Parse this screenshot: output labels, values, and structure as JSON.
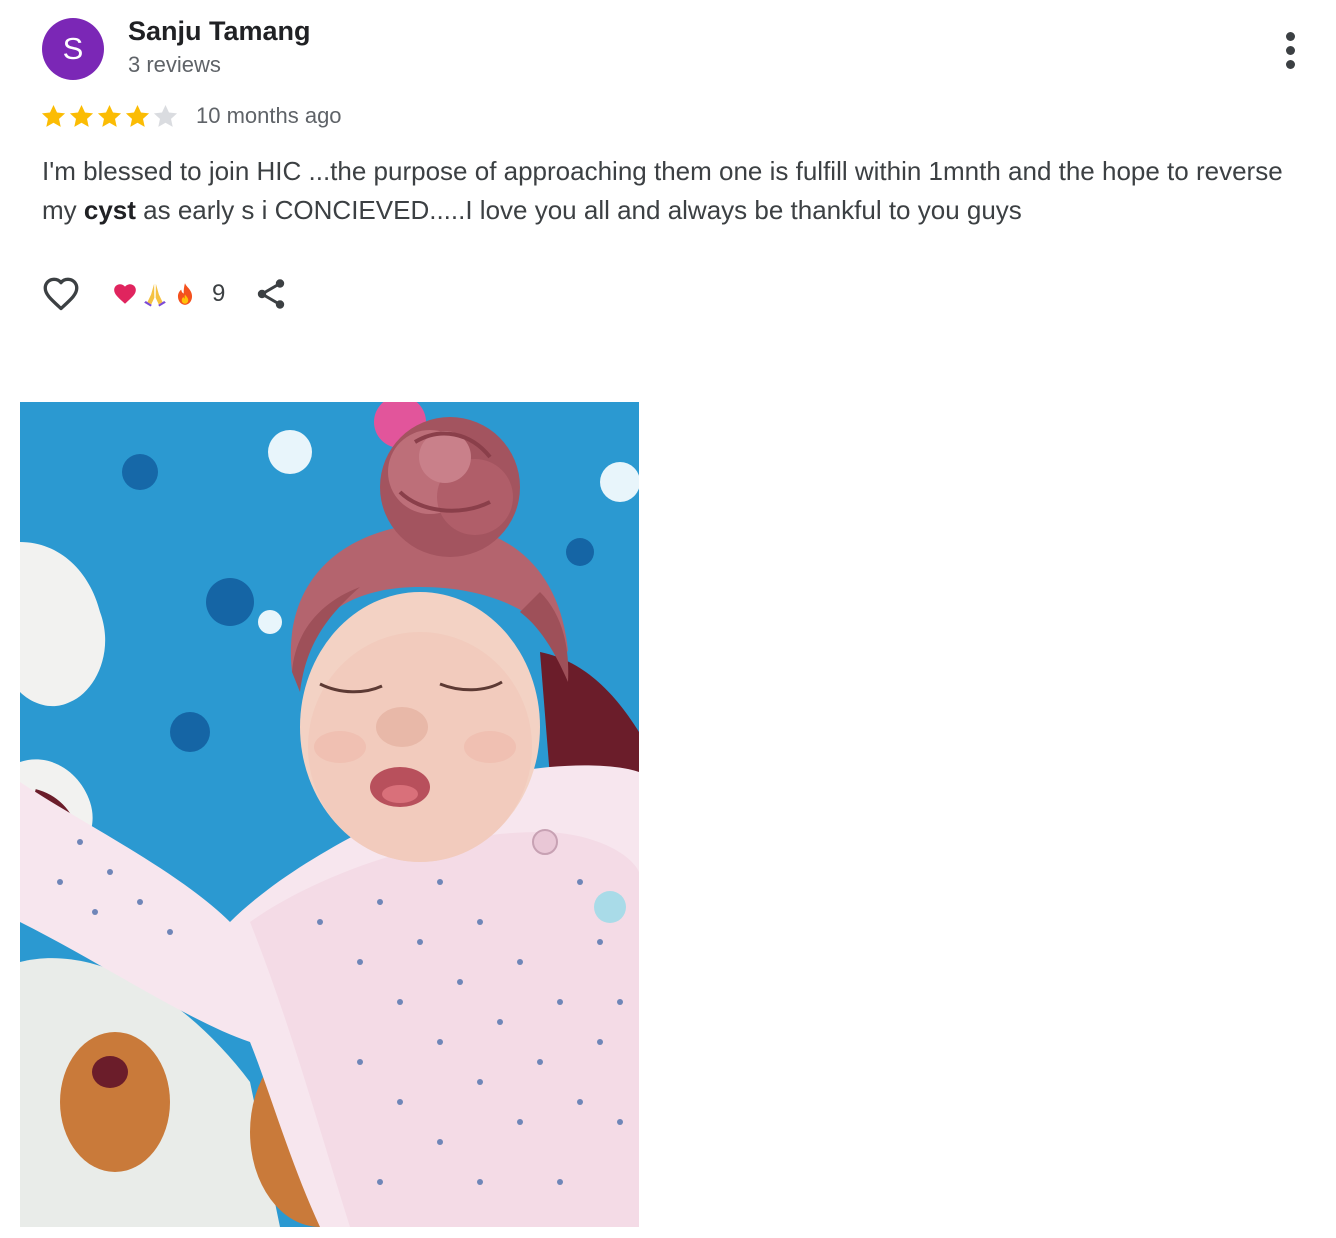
{
  "review": {
    "author": {
      "initial": "S",
      "name": "Sanju Tamang",
      "reviews_count": "3 reviews",
      "avatar_color": "#7b27b6"
    },
    "rating": {
      "stars": 4,
      "max": 5,
      "date": "10 months ago",
      "star_color": "#fbbc04",
      "empty_star_color": "#dadce0"
    },
    "text": {
      "part1": "I'm blessed to join HIC ...the purpose of approaching them one is fulfill within 1mnth and the hope to reverse my ",
      "highlight": "cyst",
      "part2": " as early s i CONCIEVED.....I love you all and always be thankful to you guys"
    },
    "actions": {
      "like_icon": "heart-outline-icon",
      "reactions": [
        "heart-emoji",
        "praying-hands-emoji",
        "fire-emoji"
      ],
      "reaction_count": "9",
      "share_icon": "share-icon",
      "more_icon": "more-vert-icon"
    },
    "photo": {
      "subject": "sleeping newborn baby in pink turban and dotted onesie on blue blanket"
    }
  }
}
